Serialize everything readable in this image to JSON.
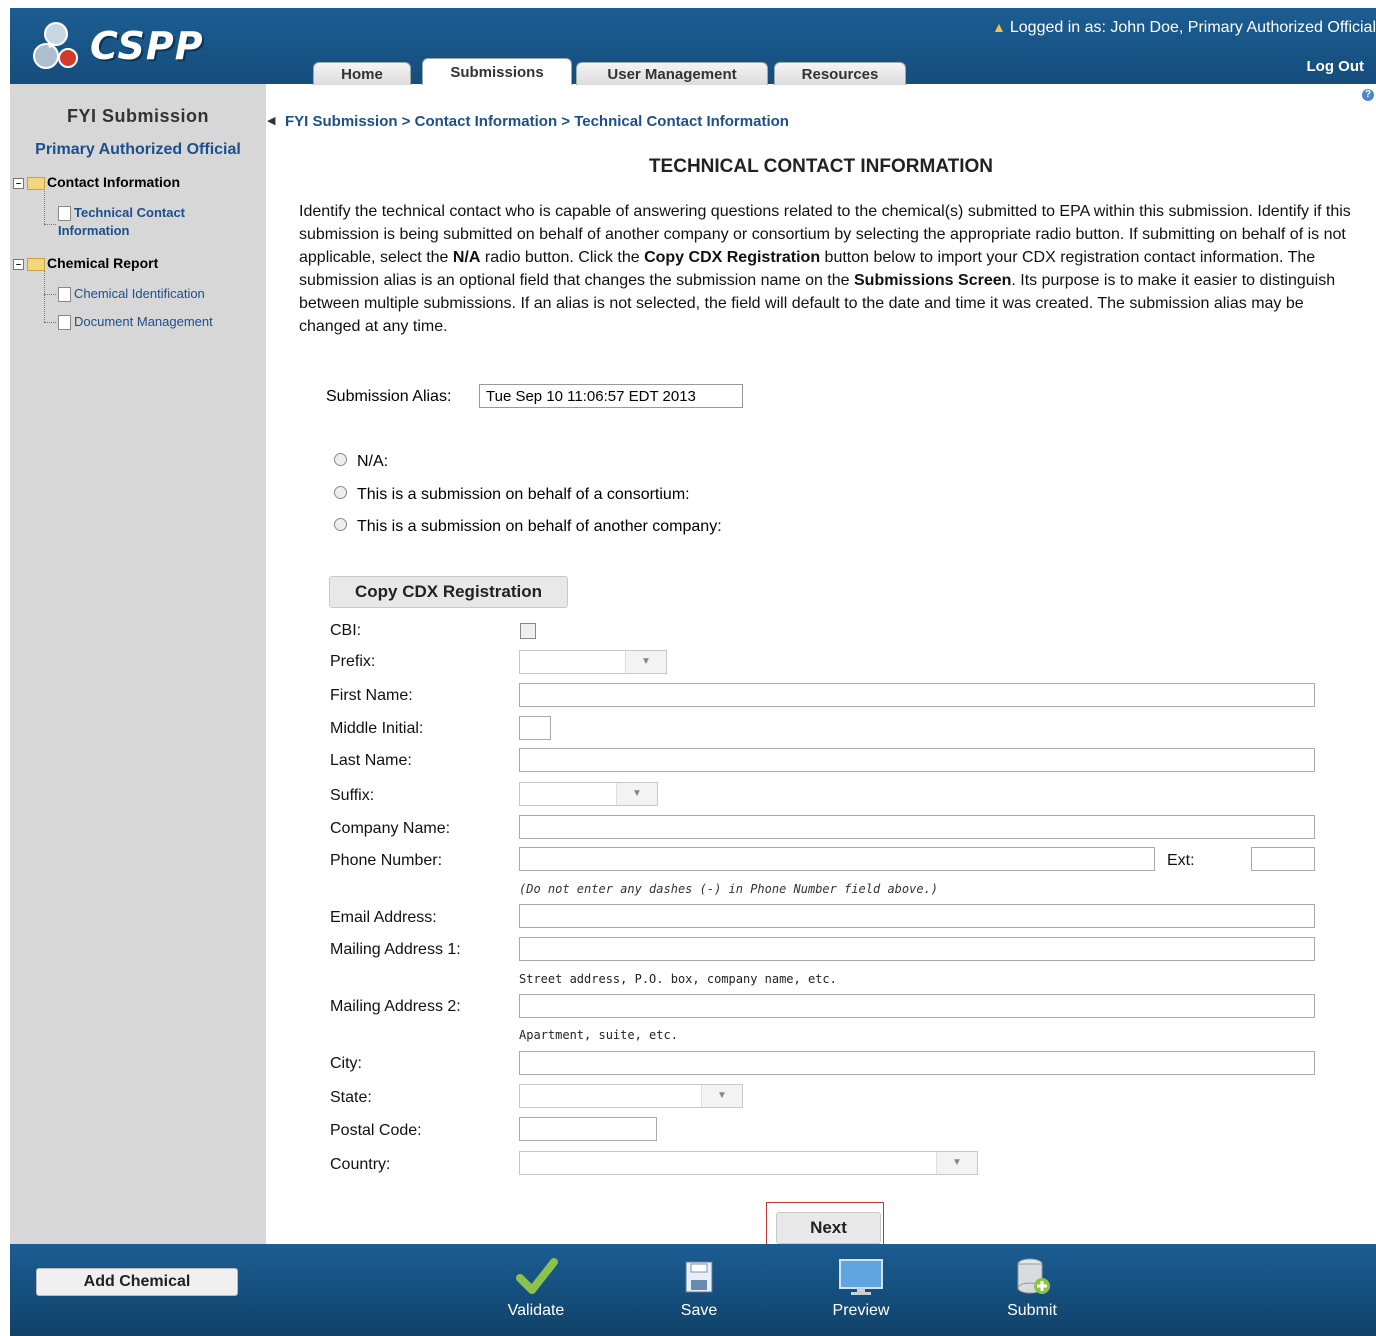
{
  "header": {
    "app_name": "CSPP",
    "logged_in_text": "Logged in as: John Doe, Primary Authorized Official",
    "logout_label": "Log Out",
    "tabs": [
      {
        "label": "Home",
        "active": false
      },
      {
        "label": "Submissions",
        "active": true
      },
      {
        "label": "User Management",
        "active": false
      },
      {
        "label": "Resources",
        "active": false
      }
    ]
  },
  "sidebar": {
    "title": "FYI Submission",
    "role": "Primary Authorized Official",
    "nodes": [
      {
        "label": "Contact Information",
        "children": [
          "Technical Contact Information"
        ]
      },
      {
        "label": "Chemical Report",
        "children": [
          "Chemical Identification",
          "Document Management"
        ]
      }
    ],
    "add_chemical_label": "Add Chemical"
  },
  "main": {
    "breadcrumb": "FYI Submission > Contact Information > Technical Contact Information",
    "page_title": "TECHNICAL CONTACT INFORMATION",
    "intro": {
      "p1": "Identify the technical contact who is capable of answering questions related to the chemical(s) submitted to EPA within this submission. Identify if this submission is being submitted on behalf of another company or consortium by selecting the appropriate radio button. If submitting on behalf of is not applicable, select the ",
      "na_bold": "N/A",
      "p2": " radio button. Click the ",
      "copy_bold": "Copy CDX Registration",
      "p3": " button below to import your CDX registration contact information. The submission alias is an optional field that changes the submission name on the ",
      "screen_bold": "Submissions Screen",
      "p4": ". Its purpose is to make it easier to distinguish between multiple submissions. If an alias is not selected, the field will default to the date and time it was created. The submission alias may be changed at any time."
    },
    "alias_label": "Submission Alias:",
    "alias_value": "Tue Sep 10 11:06:57 EDT 2013",
    "radios": [
      "N/A:",
      "This is a submission on behalf of a consortium:",
      "This is a submission on behalf of another company:"
    ],
    "copy_cdx_label": "Copy CDX Registration",
    "fields": {
      "cbi": "CBI:",
      "prefix": "Prefix:",
      "first_name": "First Name:",
      "middle_initial": "Middle Initial:",
      "last_name": "Last Name:",
      "suffix": "Suffix:",
      "company_name": "Company Name:",
      "phone_number": "Phone Number:",
      "ext": "Ext:",
      "phone_hint": "(Do not enter any dashes (-) in Phone Number field above.)",
      "email": "Email Address:",
      "mailing1": "Mailing Address 1:",
      "mailing1_hint": "Street address, P.O. box, company name, etc.",
      "mailing2": "Mailing Address 2:",
      "mailing2_hint": "Apartment, suite, etc.",
      "city": "City:",
      "state": "State:",
      "postal": "Postal Code:",
      "country": "Country:"
    },
    "next_label": "Next"
  },
  "footer": {
    "buttons": [
      {
        "label": "Validate",
        "icon": "checkmark-icon"
      },
      {
        "label": "Save",
        "icon": "floppy-disk-icon"
      },
      {
        "label": "Preview",
        "icon": "monitor-icon"
      },
      {
        "label": "Submit",
        "icon": "database-add-icon"
      }
    ]
  },
  "colors": {
    "header_blue": "#1c5d93",
    "link_blue": "#1c4f8c",
    "sidebar_gray": "#d7d7d7",
    "highlight_red": "#c0392b"
  }
}
